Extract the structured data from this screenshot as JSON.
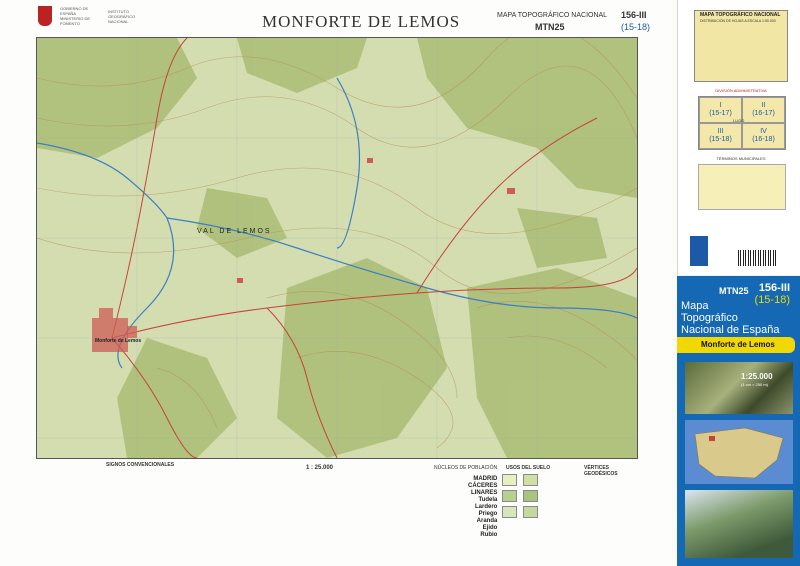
{
  "header": {
    "logo_lines": [
      "GOBIERNO DE ESPAÑA",
      "MINISTERIO DE FOMENTO",
      "INSTITUTO GEOGRÁFICO NACIONAL"
    ],
    "sheet_title": "MONFORTE DE LEMOS",
    "series_title": "MAPA TOPOGRÁFICO NACIONAL",
    "series_code": "MTN25",
    "sheet_number": "156-III",
    "sheet_grid": "(15-18)"
  },
  "map": {
    "labels": [
      "VAL DE LEMOS",
      "Monforte de Lemos"
    ]
  },
  "legend": {
    "signs_title": "SIGNOS CONVENCIONALES",
    "scale": "1 : 25.000",
    "population_title": "NÚCLEOS DE POBLACIÓN",
    "population_examples": [
      "MADRID",
      "CÁCERES",
      "LINARES",
      "Tudela",
      "Lardero",
      "Priego",
      "Aranda",
      "Ejido",
      "Rubio"
    ],
    "land_use_title": "USOS DEL SUELO",
    "geodesic_title": "VÉRTICES GEODÉSICOS"
  },
  "cover": {
    "mini_title": "MAPA TOPOGRÁFICO NACIONAL",
    "mini_sub": "DISTRIBUCIÓN DE HOJAS A ESCALA 1:50.000",
    "division_title": "DIVISIÓN ADMINISTRATIVA",
    "quadrants": [
      {
        "roman": "I",
        "code": "(15-17)"
      },
      {
        "roman": "II",
        "code": "(16-17)"
      },
      {
        "roman": "III",
        "code": "(15-18)"
      },
      {
        "roman": "IV",
        "code": "(16-18)"
      }
    ],
    "province": "LUGO",
    "terms_title": "TÉRMINOS MUNICIPALES",
    "mtn": "MTN25",
    "number": "156-III",
    "grid": "(15-18)",
    "series_lines": [
      "Mapa",
      "Topográfico",
      "Nacional de España"
    ],
    "sheet_name": "Monforte de Lemos",
    "scale": "1:25.000",
    "scale_sub": "(1 cm = 250 m)"
  },
  "colors": {
    "cover_blue": "#1468b4",
    "cover_yellow": "#f0d800",
    "map_green": "#a9bd74",
    "contour_brown": "#b98a55",
    "river_blue": "#3b7fc4",
    "road_red": "#c8423a",
    "urban_red": "#cf5b55"
  }
}
